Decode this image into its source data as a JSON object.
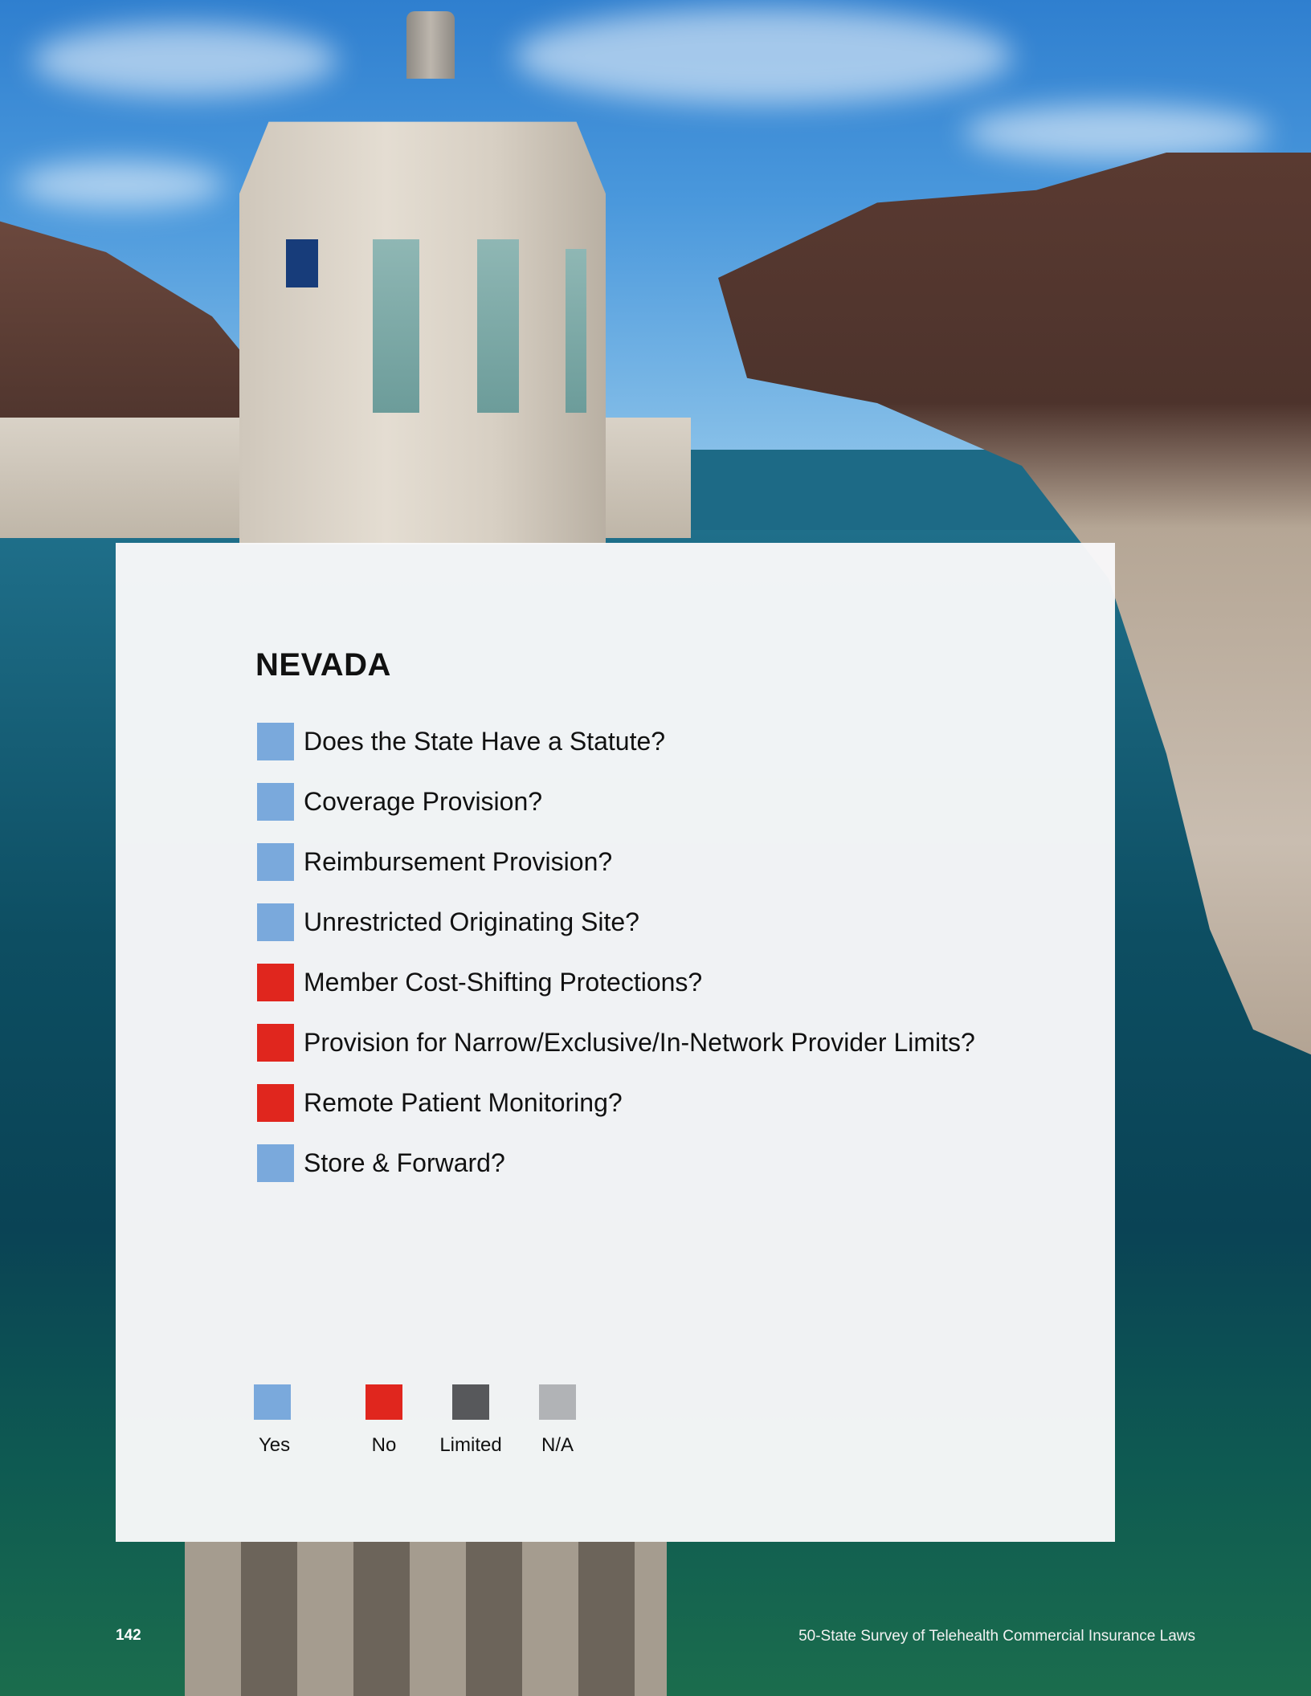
{
  "state_name": "NEVADA",
  "colors": {
    "yes": "#7aa9dc",
    "no": "#e0261e",
    "limited": "#57585b",
    "na": "#b1b3b6"
  },
  "questions": [
    {
      "label": "Does the State Have a Statute?",
      "status": "yes"
    },
    {
      "label": "Coverage Provision?",
      "status": "yes"
    },
    {
      "label": "Reimbursement Provision?",
      "status": "yes"
    },
    {
      "label": "Unrestricted Originating Site?",
      "status": "yes"
    },
    {
      "label": "Member Cost-Shifting Protections?",
      "status": "no"
    },
    {
      "label": "Provision for Narrow/Exclusive/In-Network Provider Limits?",
      "status": "no"
    },
    {
      "label": "Remote Patient Monitoring?",
      "status": "no"
    },
    {
      "label": "Store & Forward?",
      "status": "yes"
    }
  ],
  "legend": [
    {
      "label": "Yes",
      "status": "yes"
    },
    {
      "label": "No",
      "status": "no"
    },
    {
      "label": "Limited",
      "status": "limited"
    },
    {
      "label": "N/A",
      "status": "na"
    }
  ],
  "footer": {
    "page_number": "142",
    "publication_title": "50-State Survey of Telehealth Commercial Insurance Laws"
  }
}
